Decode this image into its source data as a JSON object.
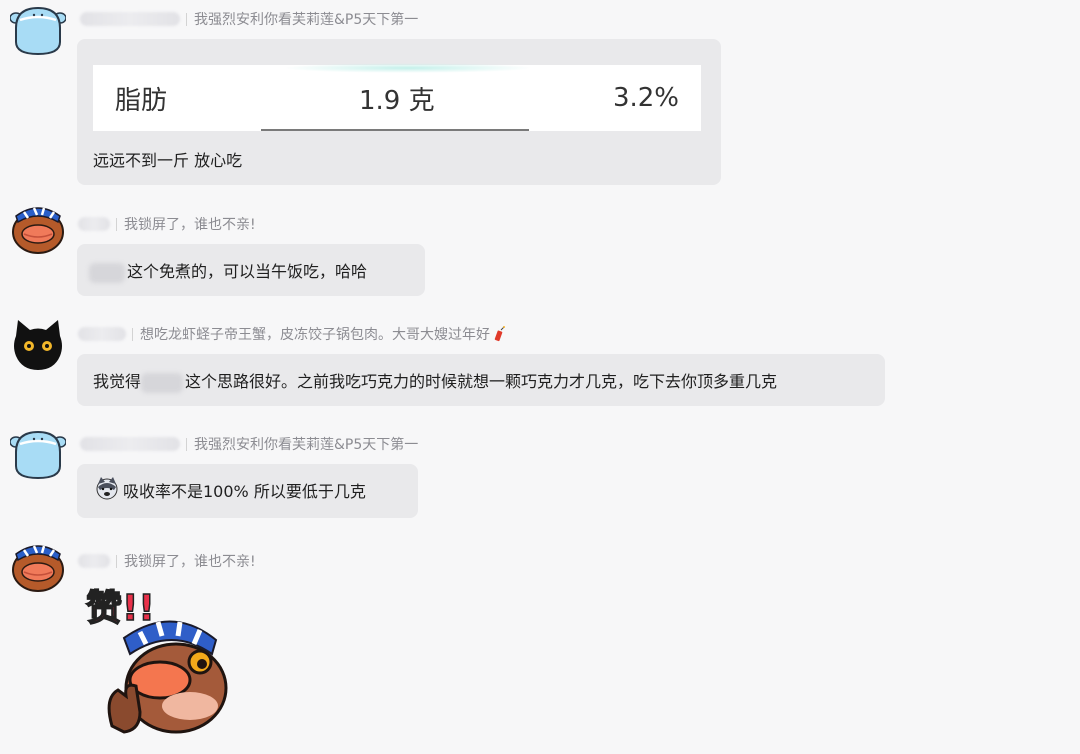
{
  "messages": [
    {
      "title": "我强烈安利你看芙莉莲&P5天下第一",
      "avatar_icon": "blue-blob-avatar",
      "nutrition": {
        "name": "脂肪",
        "amount": "1.9 克",
        "percent": "3.2%"
      },
      "text": "远远不到一斤 放心吃"
    },
    {
      "title": "我锁屏了，谁也不亲!",
      "avatar_icon": "duck-headband-avatar",
      "text": "这个免煮的，可以当午饭吃，哈哈"
    },
    {
      "title": "想吃龙虾蛏子帝王蟹，皮冻饺子锅包肉。大哥大嫂过年好",
      "avatar_icon": "black-cat-avatar",
      "title_icon": "firecracker-icon",
      "text_before": "我觉得",
      "text_after": "这个思路很好。之前我吃巧克力的时候就想一颗巧克力才几克，吃下去你顶多重几克"
    },
    {
      "title": "我强烈安利你看芙莉莲&P5天下第一",
      "avatar_icon": "blue-blob-avatar",
      "text_icon": "husky-emoji-icon",
      "text": "吸收率不是100% 所以要低于几克"
    },
    {
      "title": "我锁屏了，谁也不亲!",
      "avatar_icon": "duck-headband-avatar",
      "sticker": {
        "icon": "duck-thumbs-up-sticker",
        "text": "赞!!"
      }
    }
  ]
}
